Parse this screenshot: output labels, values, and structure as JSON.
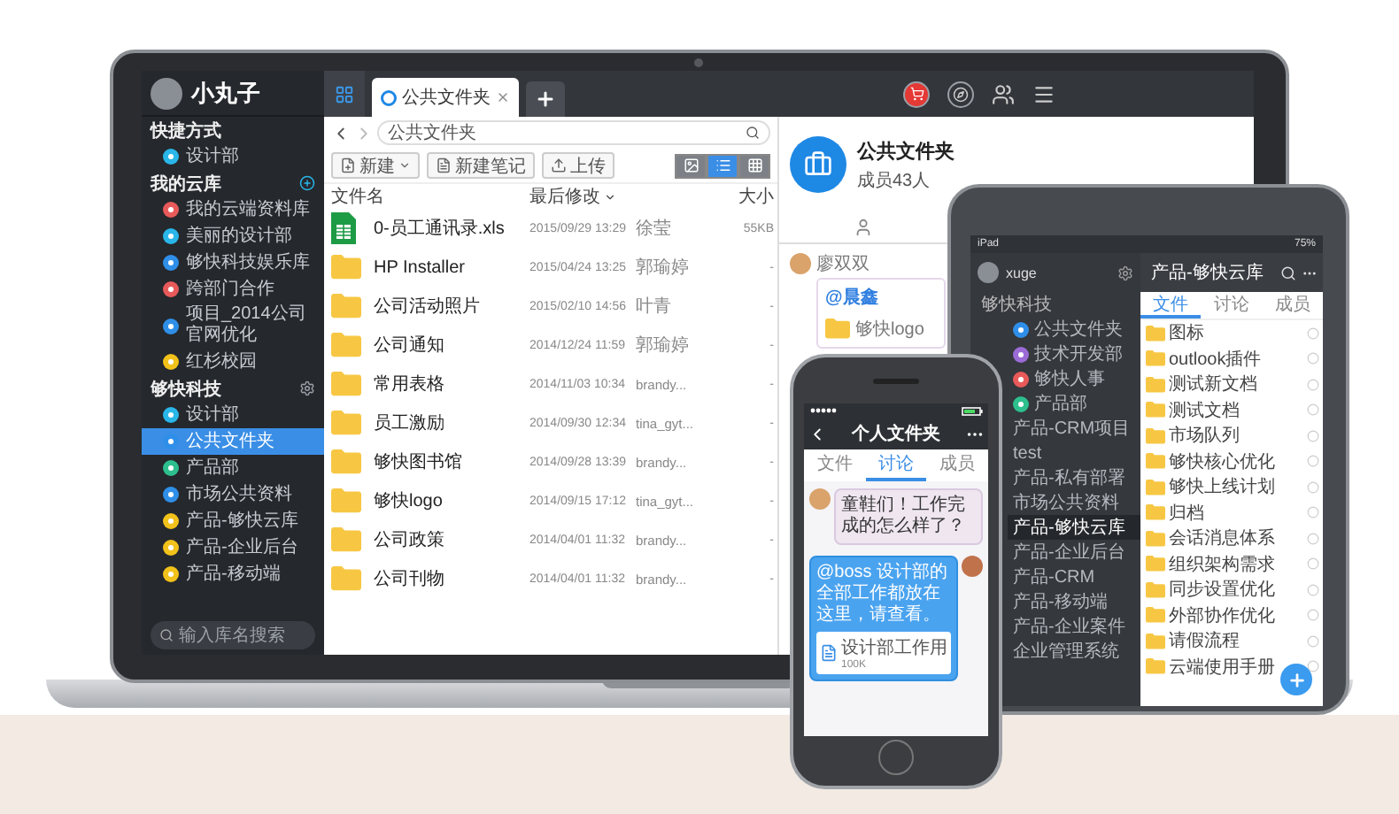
{
  "laptop": {
    "user": {
      "name": "小丸子"
    },
    "sidebar": [
      {
        "title": "快捷方式",
        "items": [
          {
            "label": "设计部",
            "color": "#29b6e8",
            "selected": false
          }
        ]
      },
      {
        "title": "我的云库",
        "kind": "add",
        "items": [
          {
            "label": "我的云端资料库",
            "color": "#e85a5a",
            "selected": false
          },
          {
            "label": "美丽的设计部",
            "color": "#29b6e8",
            "selected": false
          },
          {
            "label": "够快科技娱乐库",
            "color": "#2f8fe8",
            "selected": false
          },
          {
            "label": "跨部门合作",
            "color": "#e85a5a",
            "selected": false
          },
          {
            "label": "项目_2014公司官网优化",
            "color": "#2f8fe8",
            "selected": false
          },
          {
            "label": "红杉校园",
            "color": "#f2c21b",
            "selected": false
          }
        ]
      },
      {
        "title": "够快科技",
        "kind": "settings",
        "items": [
          {
            "label": "设计部",
            "color": "#29b6e8",
            "selected": false
          },
          {
            "label": "公共文件夹",
            "color": "#2f8fe8",
            "selected": true
          },
          {
            "label": "产品部",
            "color": "#2dbf8e",
            "selected": false
          },
          {
            "label": "市场公共资料",
            "color": "#2f8fe8",
            "selected": false
          },
          {
            "label": "产品-够快云库",
            "color": "#f2c21b",
            "selected": false
          },
          {
            "label": "产品-企业后台",
            "color": "#f2c21b",
            "selected": false
          },
          {
            "label": "产品-移动端",
            "color": "#f2c21b",
            "selected": false
          }
        ]
      }
    ],
    "search": {
      "placeholder": "输入库名搜索"
    },
    "tabs": [
      {
        "label": "公共文件夹",
        "selected": true
      }
    ],
    "path": "公共文件夹",
    "toolbar": [
      {
        "label": "新建",
        "kind": "menu"
      },
      {
        "label": "新建笔记",
        "kind": "note"
      },
      {
        "label": "上传",
        "kind": "upload"
      }
    ],
    "view_modes": [
      {
        "kind": "thumbnails",
        "selected": false
      },
      {
        "kind": "list",
        "selected": true
      },
      {
        "kind": "grid",
        "selected": false
      }
    ],
    "table": {
      "columns": [
        "文件名",
        "最后修改",
        "大小"
      ],
      "rows": [
        {
          "kind": "excel",
          "name": "0-员工通讯录.xls",
          "modified": "2015/09/29 13:29",
          "owner": "徐莹",
          "size": "55KB"
        },
        {
          "kind": "folder",
          "name": "HP Installer",
          "modified": "2015/04/24 13:25",
          "owner": "郭瑜婷",
          "size": "-"
        },
        {
          "kind": "folder",
          "name": "公司活动照片",
          "modified": "2015/02/10 14:56",
          "owner": "叶青",
          "size": "-"
        },
        {
          "kind": "folder",
          "name": "公司通知",
          "modified": "2014/12/24 11:59",
          "owner": "郭瑜婷",
          "size": "-"
        },
        {
          "kind": "folder",
          "name": "常用表格",
          "modified": "2014/11/03 10:34",
          "owner": "brandy...",
          "size": "-"
        },
        {
          "kind": "folder",
          "name": "员工激励",
          "modified": "2014/09/30 12:34",
          "owner": "tina_gyt...",
          "size": "-"
        },
        {
          "kind": "folder",
          "name": "够快图书馆",
          "modified": "2014/09/28 13:39",
          "owner": "brandy...",
          "size": "-"
        },
        {
          "kind": "folder",
          "name": "够快logo",
          "modified": "2014/09/15 17:12",
          "owner": "tina_gyt...",
          "size": "-"
        },
        {
          "kind": "folder",
          "name": "公司政策",
          "modified": "2014/04/01 11:32",
          "owner": "brandy...",
          "size": "-"
        },
        {
          "kind": "folder",
          "name": "公司刊物",
          "modified": "2014/04/01 11:32",
          "owner": "brandy...",
          "size": "-"
        }
      ]
    },
    "detail": {
      "title": "公共文件夹",
      "subtitle": "成员43人",
      "messages": [
        {
          "author": "廖双双",
          "mention": "@晨鑫",
          "attachment": "够快logo"
        }
      ]
    }
  },
  "tablet": {
    "carrier": "iPad",
    "battery": "75%",
    "user": "xuge",
    "title": "产品-够快云库",
    "tabs": [
      {
        "label": "文件",
        "selected": true
      },
      {
        "label": "讨论",
        "selected": false
      },
      {
        "label": "成员",
        "selected": false
      }
    ],
    "sidebar": {
      "title": "够快科技",
      "items": [
        {
          "label": "公共文件夹",
          "color": "#2f8fe8",
          "selected": false
        },
        {
          "label": "技术开发部",
          "color": "#9b6bd6",
          "selected": false
        },
        {
          "label": "够快人事",
          "color": "#e85a5a",
          "selected": false
        },
        {
          "label": "产品部",
          "color": "#2dbf8e",
          "selected": false
        },
        {
          "label": "产品-CRM项目",
          "selected": false
        },
        {
          "label": "test",
          "selected": false
        },
        {
          "label": "产品-私有部署",
          "selected": false
        },
        {
          "label": "市场公共资料",
          "selected": false
        },
        {
          "label": "产品-够快云库",
          "selected": true
        },
        {
          "label": "产品-企业后台",
          "selected": false
        },
        {
          "label": "产品-CRM",
          "selected": false
        },
        {
          "label": "产品-移动端",
          "selected": false
        },
        {
          "label": "产品-企业案件",
          "selected": false
        },
        {
          "label": "企业管理系统",
          "selected": false
        }
      ]
    },
    "files": [
      "图标",
      "outlook插件",
      "测试新文档",
      "测试文档",
      "市场队列",
      "够快核心优化",
      "够快上线计划",
      "归档",
      "会话消息体系",
      "组织架构需求",
      "同步设置优化",
      "外部协作优化",
      "请假流程",
      "云端使用手册"
    ]
  },
  "phone": {
    "title": "个人文件夹",
    "tabs": [
      {
        "label": "文件",
        "selected": false
      },
      {
        "label": "讨论",
        "selected": true
      },
      {
        "label": "成员",
        "selected": false
      }
    ],
    "messages": [
      {
        "kind": "received",
        "text": "童鞋们！工作完成的怎么样了？"
      },
      {
        "kind": "sent",
        "text": "@boss 设计部的全部工作都放在这里，请查看。",
        "attachment": {
          "name": "设计部工作用",
          "size": "100K"
        }
      }
    ]
  }
}
